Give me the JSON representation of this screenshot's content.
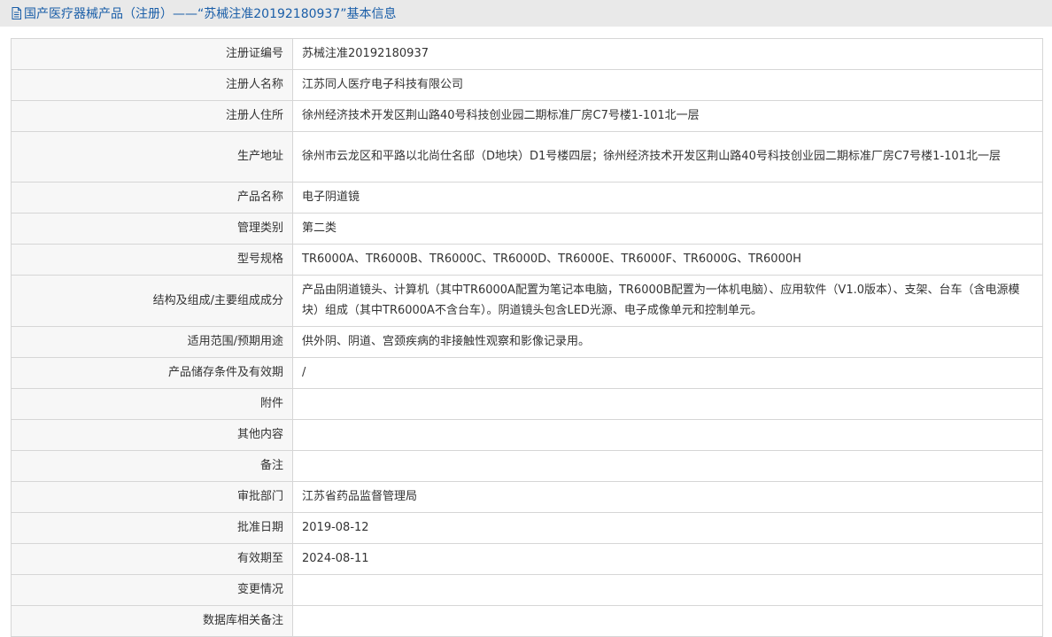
{
  "header": {
    "title": "国产医疗器械产品（注册）——“苏械注准20192180937”基本信息",
    "icon": "document-icon"
  },
  "rows": [
    {
      "label": "注册证编号",
      "value": "苏械注准20192180937"
    },
    {
      "label": "注册人名称",
      "value": "江苏同人医疗电子科技有限公司"
    },
    {
      "label": "注册人住所",
      "value": "徐州经济技术开发区荆山路40号科技创业园二期标准厂房C7号楼1-101北一层"
    },
    {
      "label": "生产地址",
      "value": "徐州市云龙区和平路以北尚仕名邸（D地块）D1号楼四层；徐州经济技术开发区荆山路40号科技创业园二期标准厂房C7号楼1-101北一层"
    },
    {
      "label": "产品名称",
      "value": "电子阴道镜"
    },
    {
      "label": "管理类别",
      "value": "第二类"
    },
    {
      "label": "型号规格",
      "value": "TR6000A、TR6000B、TR6000C、TR6000D、TR6000E、TR6000F、TR6000G、TR6000H"
    },
    {
      "label": "结构及组成/主要组成成分",
      "value": "产品由阴道镜头、计算机（其中TR6000A配置为笔记本电脑，TR6000B配置为一体机电脑）、应用软件（V1.0版本）、支架、台车（含电源模块）组成（其中TR6000A不含台车）。阴道镜头包含LED光源、电子成像单元和控制单元。"
    },
    {
      "label": "适用范围/预期用途",
      "value": "供外阴、阴道、宫颈疾病的非接触性观察和影像记录用。"
    },
    {
      "label": "产品储存条件及有效期",
      "value": "/"
    },
    {
      "label": "附件",
      "value": ""
    },
    {
      "label": "其他内容",
      "value": ""
    },
    {
      "label": "备注",
      "value": ""
    },
    {
      "label": "审批部门",
      "value": "江苏省药品监督管理局"
    },
    {
      "label": "批准日期",
      "value": "2019-08-12"
    },
    {
      "label": "有效期至",
      "value": "2024-08-11"
    },
    {
      "label": "变更情况",
      "value": ""
    },
    {
      "label": "数据库相关备注",
      "value": ""
    }
  ]
}
